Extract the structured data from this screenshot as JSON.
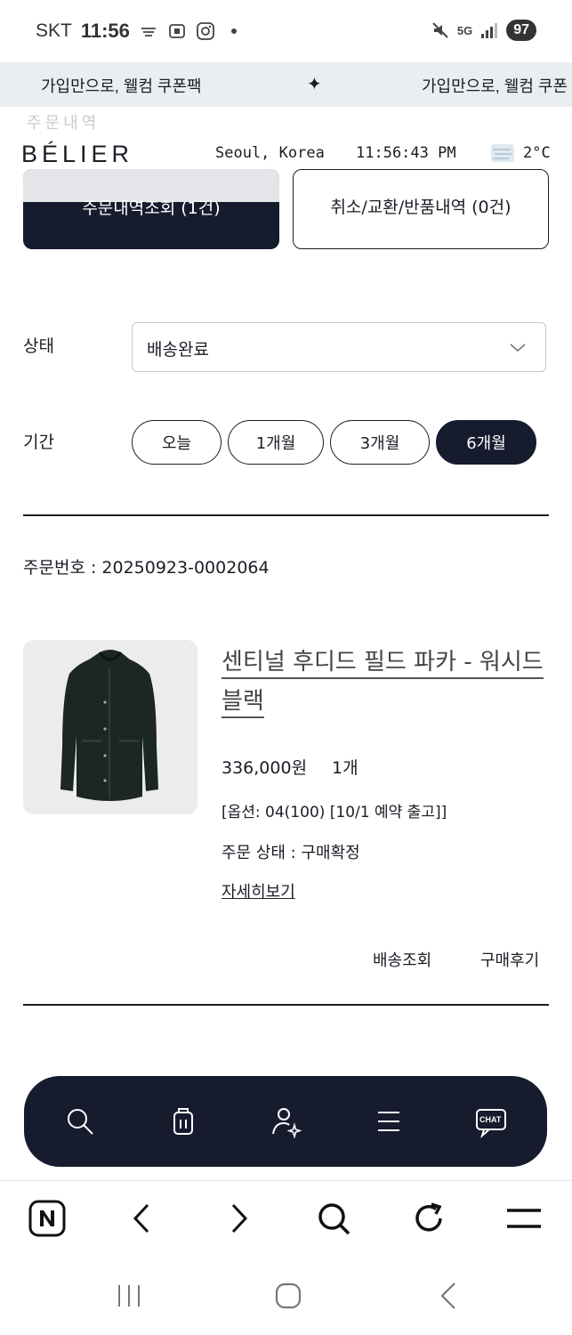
{
  "status_bar": {
    "carrier": "SKT",
    "time": "11:56",
    "battery": "97",
    "network": "5G"
  },
  "banner": {
    "text": "가입만으로, 웰컴 쿠폰팩",
    "text_repeat": "가입만으로, 웰컴 쿠폰",
    "separator": "✦"
  },
  "header": {
    "faint_text": "주문내역",
    "logo": "BÉLIER",
    "location": "Seoul, Korea",
    "clock": "11:56:43 PM",
    "temperature": "2°C",
    "weather_icon": "fog-icon"
  },
  "tabs": {
    "orders": "주문내역조회 (1건)",
    "cancel": "취소/교환/반품내역 (0건)"
  },
  "filter": {
    "status_label": "상태",
    "status_value": "배송완료",
    "period_label": "기간",
    "periods": [
      "오늘",
      "1개월",
      "3개월",
      "6개월"
    ],
    "active_period": "6개월"
  },
  "order": {
    "number": "주문번호 : 20250923-0002064",
    "product_name": "센티널 후디드 필드 파카 - 워시드 블랙",
    "price": "336,000원",
    "quantity": "1개",
    "option": "[옵션: 04(100) [10/1 예약 출고]]",
    "status": "주문 상태 : 구매확정",
    "detail_link": "자세히보기",
    "actions": [
      "배송조회",
      "구매후기"
    ]
  },
  "floating_nav": {
    "chat_label": "CHAT",
    "icons": [
      "search-icon",
      "shopping-bag-icon",
      "user-icon",
      "menu-icon",
      "chat-icon"
    ]
  },
  "browser_bar": {
    "icons": [
      "naver-icon",
      "back-icon",
      "forward-icon",
      "search-icon",
      "refresh-icon",
      "menu-icon"
    ]
  },
  "colors": {
    "navy": "#161b2e",
    "banner_bg": "#e9eef2",
    "image_bg": "#ececee"
  }
}
